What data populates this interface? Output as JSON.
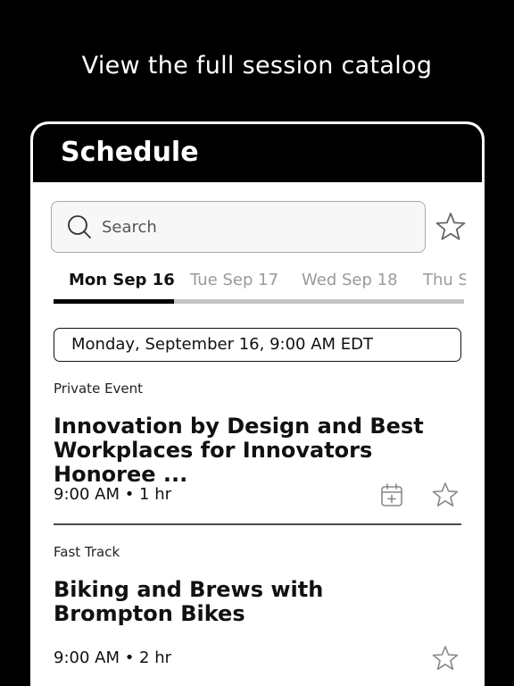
{
  "promo": {
    "headline": "View the full session catalog"
  },
  "header": {
    "title": "Schedule"
  },
  "search": {
    "placeholder": "Search"
  },
  "tabs": [
    {
      "label": "Mon Sep 16",
      "active": true
    },
    {
      "label": "Tue Sep 17",
      "active": false
    },
    {
      "label": "Wed Sep 18",
      "active": false
    },
    {
      "label": "Thu S",
      "active": false
    }
  ],
  "date_header": "Monday, September 16,  9:00 AM EDT",
  "sessions": [
    {
      "category": "Private Event",
      "title": "Innovation by Design and Best Workplaces for Innovators Honoree ...",
      "time": "9:00 AM • 1 hr",
      "icons": [
        "add-to-calendar-icon",
        "star-icon"
      ]
    },
    {
      "category": "Fast Track",
      "title": "Biking and Brews with Brompton Bikes",
      "time": "9:00 AM • 2 hr",
      "icons": [
        "star-icon"
      ]
    }
  ],
  "colors": {
    "header_bg": "#000000",
    "active_tab": "#111111",
    "inactive_tab": "#9a9a9a"
  }
}
